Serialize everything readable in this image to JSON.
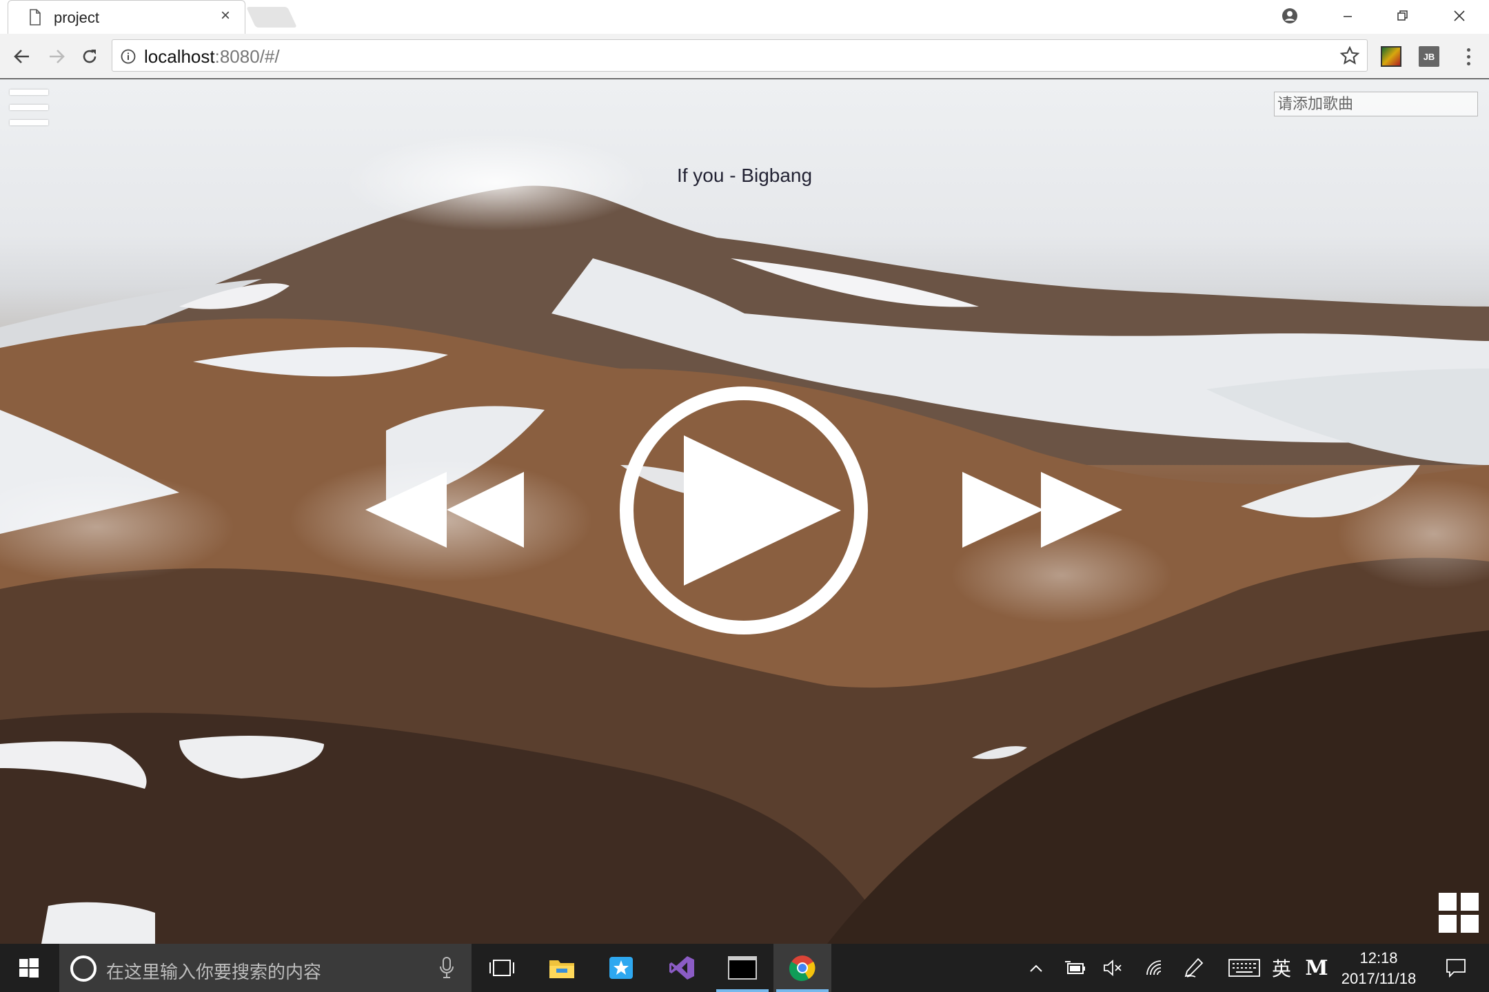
{
  "browser": {
    "tab_title": "project",
    "tab_close": "×",
    "url_host": "localhost",
    "url_rest": ":8080/#/",
    "extension_2_label": "JB"
  },
  "page": {
    "search_placeholder": "请添加歌曲",
    "song_title": "If you - Bigbang"
  },
  "taskbar": {
    "search_placeholder": "在这里输入你要搜索的内容",
    "ime_label": "英",
    "m_label": "M",
    "clock_time": "12:18",
    "clock_date": "2017/11/18"
  },
  "colors": {
    "accent": "#76b9ed",
    "taskbar_bg": "#1f1f1f",
    "searchbox_bg": "#3a3a3a"
  }
}
